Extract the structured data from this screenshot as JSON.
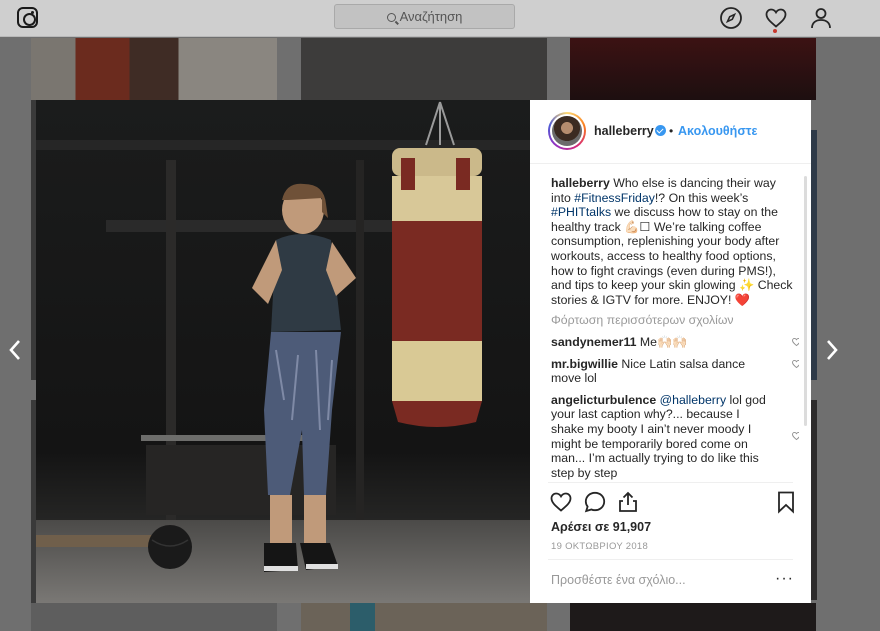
{
  "search": {
    "placeholder": "Αναζήτηση"
  },
  "post": {
    "username": "halleberry",
    "follow_label": "Ακολουθήστε",
    "caption": {
      "user": "halleberry",
      "text_1": " Who else is dancing their way into ",
      "tag_1": "#FitnessFriday",
      "text_2": "!? On this week’s ",
      "tag_2": "#PHITtalks",
      "text_3": " we discuss how to stay on the healthy track 💪🏻☐ We’re talking coffee consumption, replenishing your body after workouts, access to healthy food options, how to fight cravings (even during PMS!), and tips to keep your skin glowing ✨ Check stories & IGTV for more. ENJOY! ❤️"
    },
    "load_more": "Φόρτωση περισσότερων σχολίων",
    "comments": [
      {
        "user": "sandynemer11",
        "text": " Me🙌🏻🙌🏻"
      },
      {
        "user": "mr.bigwillie",
        "text": " Nice Latin salsa dance move lol"
      },
      {
        "user": "angelicturbulence",
        "mention": " @halleberry",
        "text": " lol god your last caption why?... because I shake my booty I ain’t never moody I might be temporarily bored come on man... I’m actually trying to do like this step by step"
      }
    ],
    "likes": "Αρέσει σε 91,907",
    "date": "19 ΟΚΤΩΒΡΙΟΥ 2018",
    "add_comment_placeholder": "Προσθέστε ένα σχόλιο...",
    "more_label": "···"
  },
  "icons": [
    "instagram-logo-icon",
    "search-icon",
    "compass-icon",
    "heart-icon",
    "profile-icon",
    "verified-icon",
    "comment-icon",
    "share-icon",
    "save-icon",
    "chevron-left-icon",
    "chevron-right-icon"
  ]
}
